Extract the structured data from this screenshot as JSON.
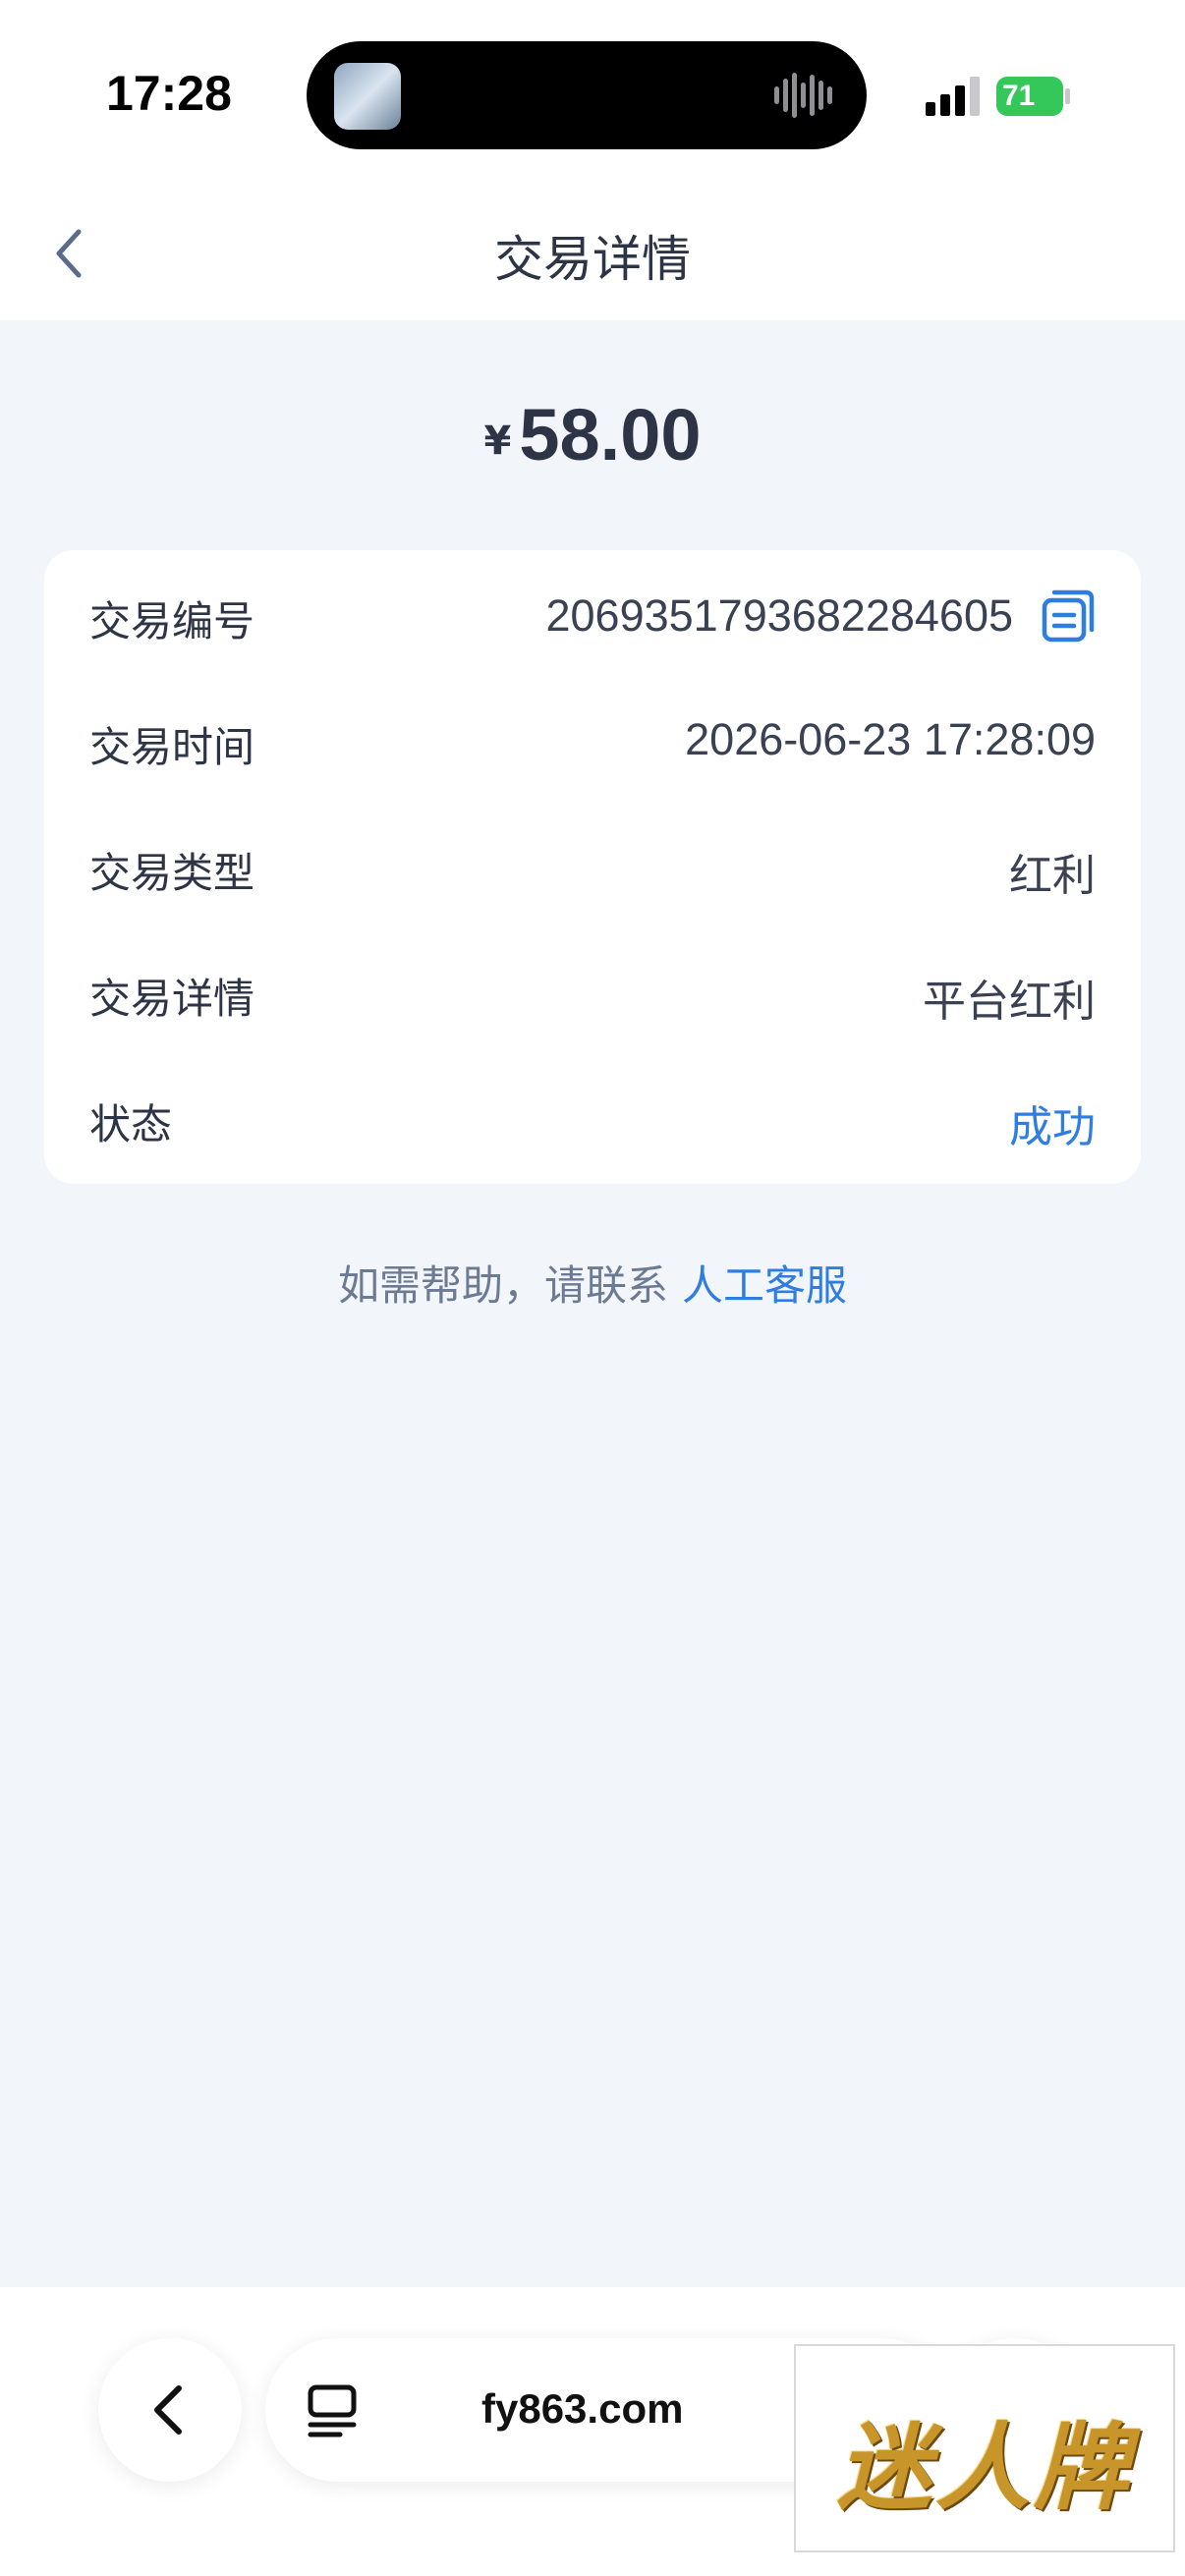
{
  "status_bar": {
    "time": "17:28",
    "battery": "71"
  },
  "header": {
    "title": "交易详情"
  },
  "amount": {
    "currency": "¥",
    "value": "58.00"
  },
  "details": {
    "id_label": "交易编号",
    "id_value": "2069351793682284605",
    "time_label": "交易时间",
    "time_value": "2026-06-23 17:28:09",
    "type_label": "交易类型",
    "type_value": "红利",
    "detail_label": "交易详情",
    "detail_value": "平台红利",
    "status_label": "状态",
    "status_value": "成功"
  },
  "help": {
    "text": "如需帮助，请联系",
    "link": "人工客服"
  },
  "browser": {
    "url": "fy863.com"
  },
  "watermark": {
    "text": "迷人牌"
  },
  "colors": {
    "accent": "#2f7de1",
    "background": "#f2f6fb",
    "text": "#2d3445"
  }
}
